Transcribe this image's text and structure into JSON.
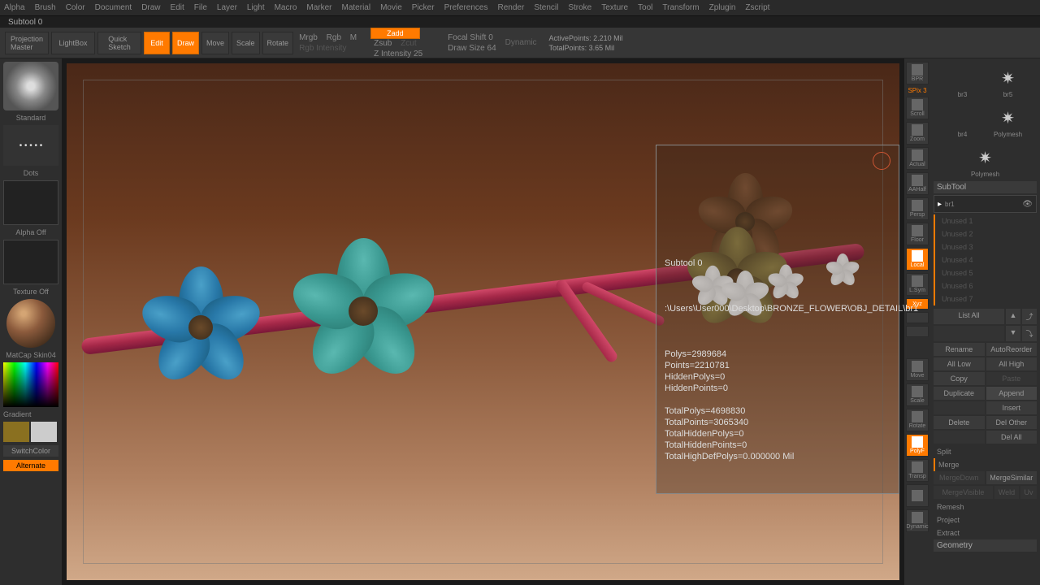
{
  "menu": [
    "Alpha",
    "Brush",
    "Color",
    "Document",
    "Draw",
    "Edit",
    "File",
    "Layer",
    "Light",
    "Macro",
    "Marker",
    "Material",
    "Movie",
    "Picker",
    "Preferences",
    "Render",
    "Stencil",
    "Stroke",
    "Texture",
    "Tool",
    "Transform",
    "Zplugin",
    "Zscript"
  ],
  "title": "Subtool 0",
  "toolbar": {
    "projection": "Projection\nMaster",
    "lightbox": "LightBox",
    "quicksketch": "Quick\nSketch",
    "edit": "Edit",
    "draw": "Draw",
    "move": "Move",
    "scale": "Scale",
    "rotate": "Rotate",
    "mrgb": "Mrgb",
    "rgb": "Rgb",
    "m": "M",
    "rgb_int": "Rgb Intensity",
    "zadd": "Zadd",
    "zsub": "Zsub",
    "zcut": "Zcut",
    "zint": "Z Intensity 25",
    "focal": "Focal Shift 0",
    "drawsize": "Draw Size 64",
    "dynamic": "Dynamic",
    "active": "ActivePoints: 2.210 Mil",
    "total": "TotalPoints: 3.65 Mil"
  },
  "left": {
    "brush": "Standard",
    "dots": "Dots",
    "alpha": "Alpha Off",
    "texture": "Texture Off",
    "matcap": "MatCap Skin04",
    "gradient": "Gradient",
    "switch": "SwitchColor",
    "alternate": "Alternate"
  },
  "righttools": [
    "BPR",
    "SPix 3",
    "Scroll",
    "Zoom",
    "Actual",
    "AAHalf",
    "Persp",
    "Floor",
    "Local",
    "L.Sym",
    "Xyz",
    "",
    "",
    "",
    "Move",
    "Scale",
    "Rotate",
    "PolyF",
    "Transp",
    "",
    "Dynamic"
  ],
  "rightpanel": {
    "thumbs": [
      "br3",
      "br5",
      "br4",
      "Polymesh",
      "Polymesh"
    ],
    "subtool_hdr": "SubTool",
    "subtool_name": "br1",
    "unused": [
      "Unused 1",
      "Unused 2",
      "Unused 3",
      "Unused 4",
      "Unused 5",
      "Unused 6",
      "Unused 7"
    ],
    "listall": "List All",
    "rename": "Rename",
    "autoreorder": "AutoReorder",
    "alllow": "All Low",
    "allhigh": "All High",
    "copy": "Copy",
    "paste": "Paste",
    "duplicate": "Duplicate",
    "append": "Append",
    "insert": "Insert",
    "delete": "Delete",
    "delother": "Del Other",
    "delall": "Del All",
    "split": "Split",
    "merge": "Merge",
    "mergedown": "MergeDown",
    "mergesimilar": "MergeSimilar",
    "mergevisible": "MergeVisible",
    "weld": "Weld",
    "uv": "Uv",
    "remesh": "Remesh",
    "project": "Project",
    "extract": "Extract",
    "geometry": "Geometry"
  },
  "overlay": {
    "title": "Subtool 0",
    "path": ":\\Users\\User000\\Desktop\\BRONZE_FLOWER\\OBJ_DETAIL\\br1",
    "stats": "Polys=2989684\nPoints=2210781\nHiddenPolys=0\nHiddenPoints=0\n\nTotalPolys=4698830\nTotalPoints=3065340\nTotalHiddenPolys=0\nTotalHiddenPoints=0\nTotalHighDefPolys=0.000000 Mil"
  }
}
